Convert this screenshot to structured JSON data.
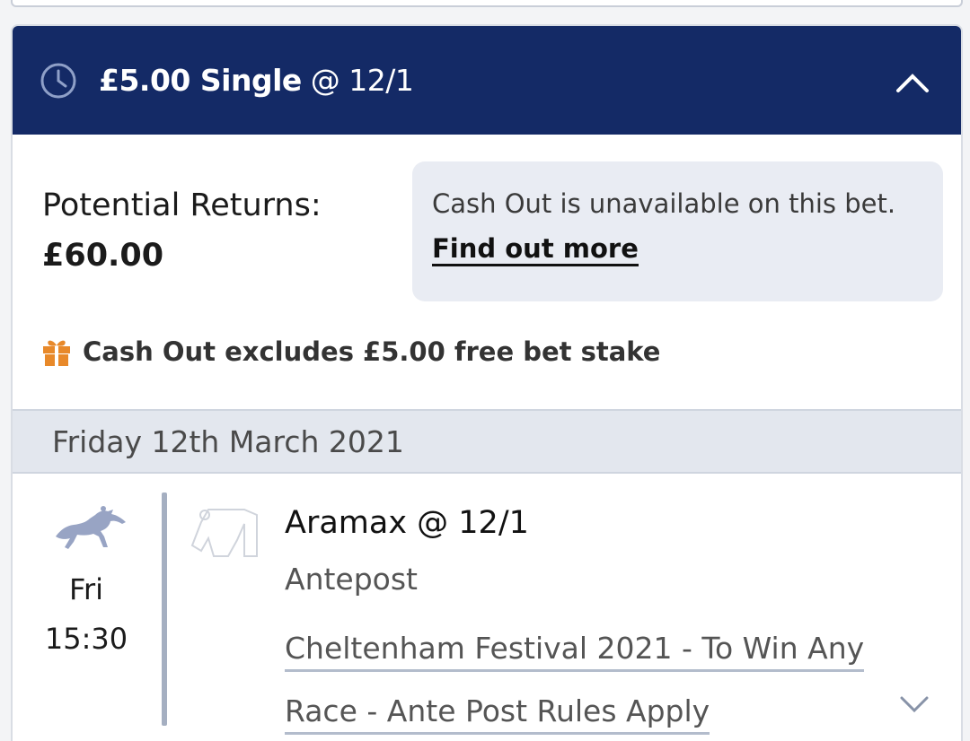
{
  "header": {
    "title_strong": "£5.00 Single",
    "title_odds": "@ 12/1",
    "bg_color": "#142a66"
  },
  "returns": {
    "label": "Potential Returns:",
    "value": "£60.00"
  },
  "cashout": {
    "message": "Cash Out is unavailable on this bet.",
    "link": "Find out more"
  },
  "freebet": {
    "text": "Cash Out excludes £5.00 free bet stake",
    "icon": "gift-icon",
    "icon_color": "#e8892a"
  },
  "date": "Friday 12th March 2021",
  "event": {
    "day": "Fri",
    "time": "15:30",
    "selection": "Aramax @ 12/1",
    "market": "Antepost",
    "race": "Cheltenham Festival 2021 - To Win Any Race - Ante Post Rules Apply"
  }
}
